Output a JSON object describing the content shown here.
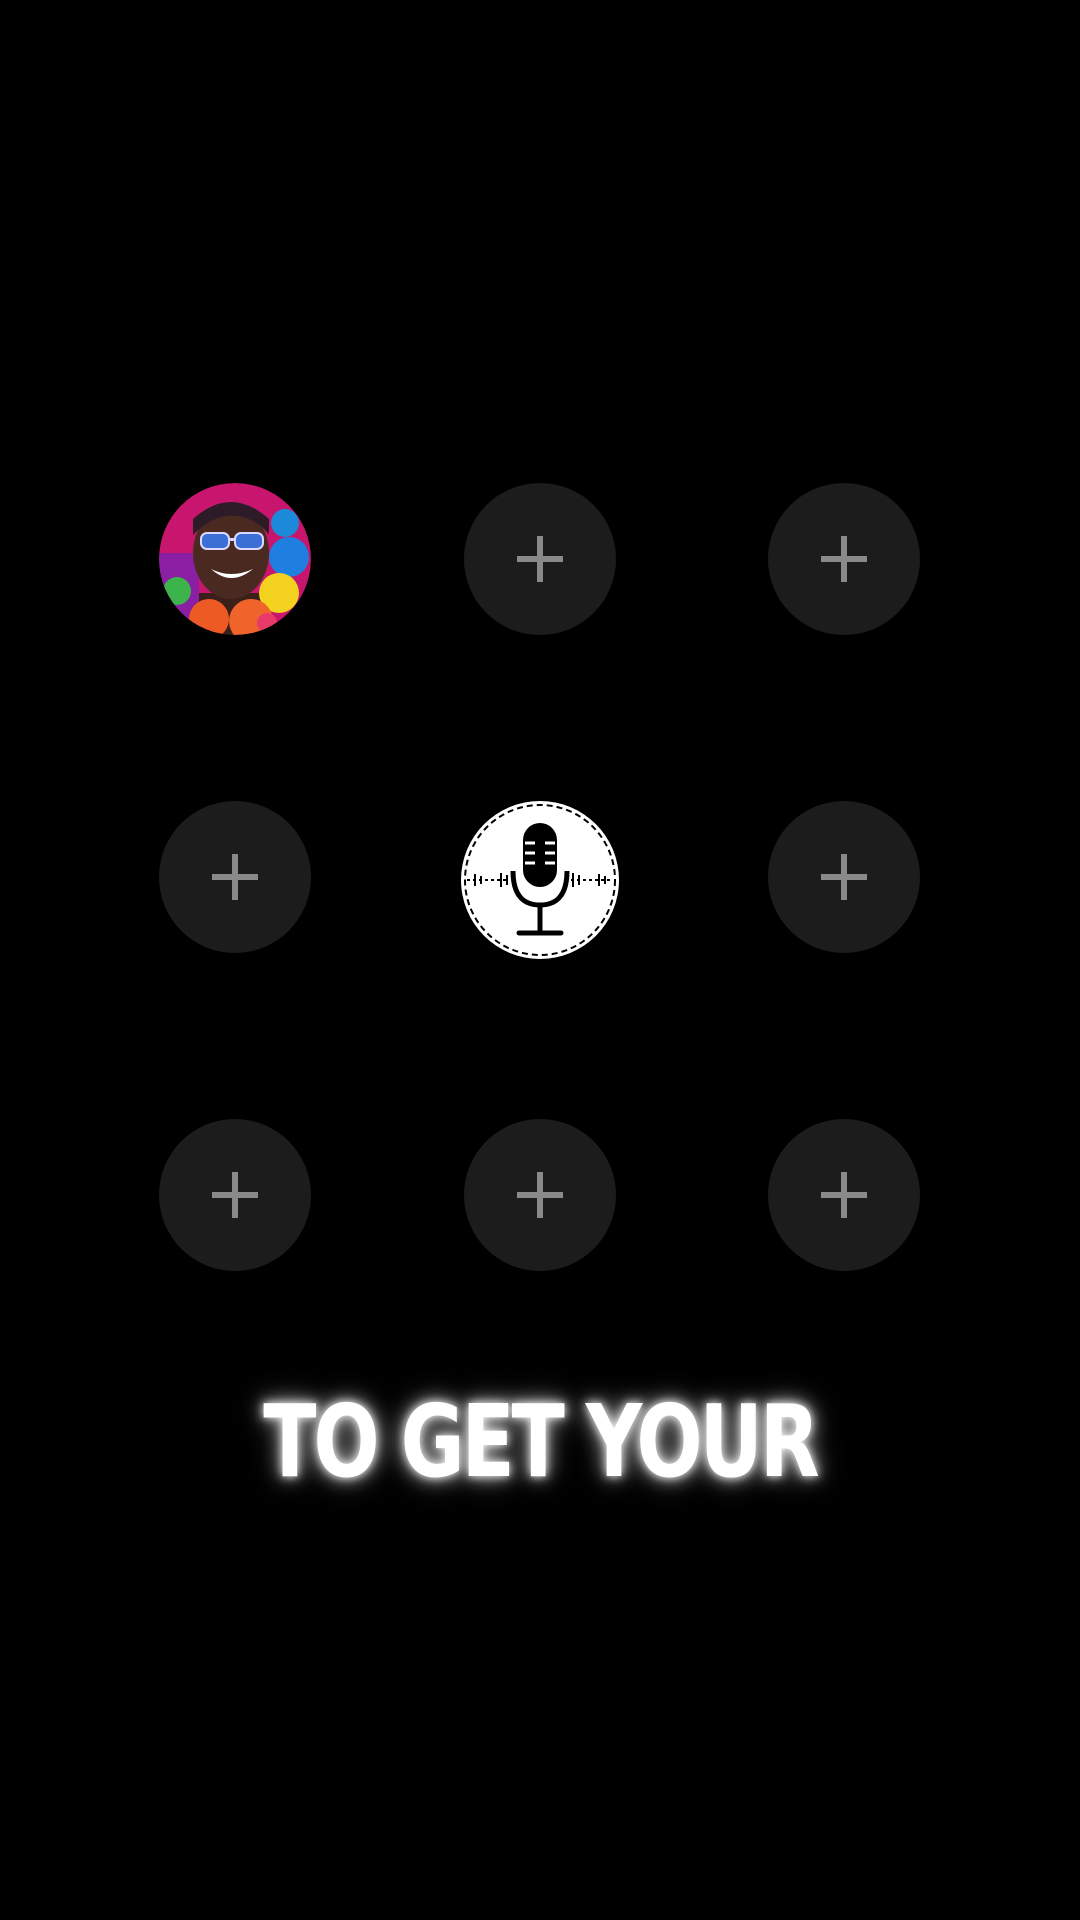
{
  "caption": {
    "text": "TO GET YOUR"
  },
  "colors": {
    "background": "#000000",
    "empty_slot": "#1c1c1c",
    "plus_icon": "#8a8a8a",
    "mic_background": "#ffffff",
    "mic_icon": "#000000",
    "caption_text": "#ffffff"
  },
  "grid": {
    "rows": 3,
    "columns": 3,
    "slots": [
      {
        "kind": "avatar",
        "icon": "avatar-photo"
      },
      {
        "kind": "add",
        "icon": "plus-icon"
      },
      {
        "kind": "add",
        "icon": "plus-icon"
      },
      {
        "kind": "add",
        "icon": "plus-icon"
      },
      {
        "kind": "record",
        "icon": "microphone-icon"
      },
      {
        "kind": "add",
        "icon": "plus-icon"
      },
      {
        "kind": "add",
        "icon": "plus-icon"
      },
      {
        "kind": "add",
        "icon": "plus-icon"
      },
      {
        "kind": "add",
        "icon": "plus-icon"
      }
    ]
  }
}
